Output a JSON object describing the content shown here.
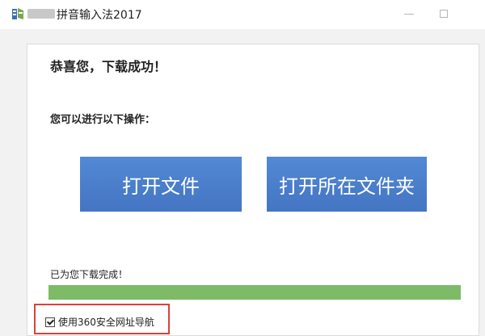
{
  "window": {
    "title": "拼音输入法2017",
    "icon": "installer-icon",
    "controls": {
      "minimize_icon": "minimize-icon",
      "maximize_icon": "maximize-icon"
    }
  },
  "content": {
    "heading": "恭喜您，下载成功！",
    "subheading": "您可以进行以下操作：",
    "buttons": {
      "open_file": "打开文件",
      "open_folder": "打开所在文件夹"
    },
    "download_status": "已为您下载完成！",
    "progress_percent": 100,
    "checkbox": {
      "label": "使用360安全网址导航",
      "checked": true
    }
  },
  "colors": {
    "button_blue": "#4a7fcb",
    "progress_green": "#7dbb66",
    "highlight_red": "#d9423b"
  }
}
